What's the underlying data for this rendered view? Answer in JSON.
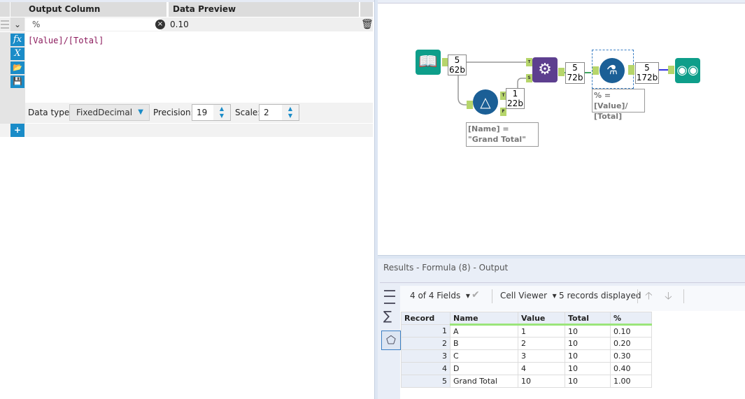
{
  "formula_panel": {
    "headers": {
      "output_column": "Output Column",
      "data_preview": "Data Preview"
    },
    "row": {
      "output_column": "%",
      "preview": "0.10",
      "expression": "[Value]/[Total]"
    },
    "data_type_label": "Data type:",
    "data_type": "FixedDecimal",
    "precision_label": "Precision:",
    "precision": "19",
    "scale_label": "Scale:",
    "scale": "2",
    "icons": [
      "fx-icon",
      "variable-icon",
      "open-folder-icon",
      "save-icon"
    ]
  },
  "canvas": {
    "counts": [
      {
        "records": "5",
        "size": "62b"
      },
      {
        "records": "1",
        "size": "22b"
      },
      {
        "records": "5",
        "size": "72b"
      },
      {
        "records": "5",
        "size": "172b"
      }
    ],
    "anchors": {
      "true": "T",
      "false": "F",
      "source": "S"
    },
    "annotations": {
      "filter": "[Name] = \"Grand Total\"",
      "formula": "% = [Value]/ [Total]"
    },
    "colors": {
      "teal": "#0e9e8a",
      "blue": "#1b5f96",
      "purple": "#5d3f8f",
      "anchor": "#b6d56b"
    }
  },
  "results": {
    "title": "Results - Formula (8) - Output",
    "fields": "4 of 4 Fields",
    "viewer": "Cell Viewer",
    "records_displayed": "5 records displayed",
    "columns": [
      "Record",
      "Name",
      "Value",
      "Total",
      "%"
    ],
    "rows": [
      [
        "1",
        "A",
        "1",
        "10",
        "0.10"
      ],
      [
        "2",
        "B",
        "2",
        "10",
        "0.20"
      ],
      [
        "3",
        "C",
        "3",
        "10",
        "0.30"
      ],
      [
        "4",
        "D",
        "4",
        "10",
        "0.40"
      ],
      [
        "5",
        "Grand Total",
        "10",
        "10",
        "1.00"
      ]
    ]
  }
}
